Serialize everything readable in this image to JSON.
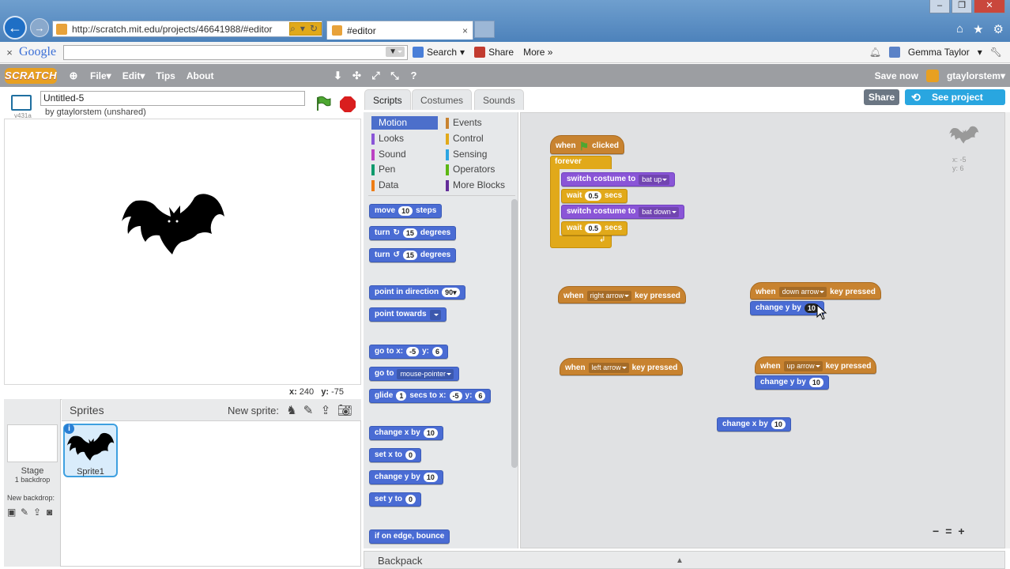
{
  "browser": {
    "url": "http://scratch.mit.edu/projects/46641988/#editor",
    "tab_title": "#editor",
    "tab_close": "×",
    "back": "←",
    "forward": "→"
  },
  "google_toolbar": {
    "close": "×",
    "logo": "Google",
    "search_label": "Search",
    "share_label": "Share",
    "more_label": "More »",
    "user_name": "Gemma Taylor"
  },
  "scratch_menu": {
    "logo": "SCRATCH",
    "file": "File▾",
    "edit": "Edit▾",
    "tips": "Tips",
    "about": "About",
    "save_now": "Save now",
    "username": "gtaylorstem▾"
  },
  "project": {
    "title": "Untitled-5",
    "owner": "by gtaylorstem (unshared)",
    "version": "v431a"
  },
  "stage": {
    "mouse_x_label": "x:",
    "mouse_x": "240",
    "mouse_y_label": "y:",
    "mouse_y": "-75"
  },
  "sprites_pane": {
    "title": "Sprites",
    "new_sprite": "New sprite:",
    "stage_label": "Stage",
    "backdrop_count": "1 backdrop",
    "new_backdrop": "New backdrop:",
    "sprite1": "Sprite1",
    "info": "i"
  },
  "tabs": {
    "scripts": "Scripts",
    "costumes": "Costumes",
    "sounds": "Sounds",
    "share": "Share",
    "see_project": "See project page"
  },
  "categories": {
    "motion": "Motion",
    "looks": "Looks",
    "sound": "Sound",
    "pen": "Pen",
    "data": "Data",
    "events": "Events",
    "control": "Control",
    "sensing": "Sensing",
    "operators": "Operators",
    "more_blocks": "More Blocks",
    "colors": {
      "motion": "#4a6cd4",
      "looks": "#8a55d7",
      "sound": "#bb42c3",
      "pen": "#0e9a6c",
      "data": "#ee7d16",
      "events": "#c88330",
      "control": "#e1a91a",
      "sensing": "#2ca5e2",
      "operators": "#5cb712",
      "more_blocks": "#632d99"
    }
  },
  "palette": {
    "move": "move",
    "move_val": "10",
    "steps": "steps",
    "turn": "turn",
    "turn_cw_val": "15",
    "turn_ccw_val": "15",
    "degrees": "degrees",
    "point_dir": "point in direction",
    "point_dir_val": "90▾",
    "point_towards": "point towards",
    "goto_xy": "go to x:",
    "goto_x": "-5",
    "y_label": "y:",
    "goto_y": "6",
    "goto": "go to",
    "goto_target": "mouse-pointer",
    "glide": "glide",
    "glide_secs": "1",
    "secs_to_x": "secs to x:",
    "glide_x": "-5",
    "glide_y": "6",
    "change_x": "change x by",
    "change_x_val": "10",
    "set_x": "set x to",
    "set_x_val": "0",
    "change_y": "change y by",
    "change_y_val": "10",
    "set_y": "set y to",
    "set_y_val": "0",
    "bounce": "if on edge, bounce"
  },
  "scripts": {
    "when": "when",
    "clicked": "clicked",
    "forever": "forever",
    "switch_costume": "switch costume to",
    "costume_up": "bat up",
    "costume_down": "bat down",
    "wait": "wait",
    "wait_val": "0.5",
    "secs": "secs",
    "key_pressed": "key pressed",
    "right_arrow": "right arrow",
    "left_arrow": "left arrow",
    "down_arrow": "down arrow",
    "up_arrow": "up arrow",
    "change_y": "change y by",
    "change_y_down_val": "10",
    "change_y_up_val": "10",
    "change_x": "change x by",
    "change_x_val": "10",
    "sprite_x": "x: -5",
    "sprite_y": "y: 6",
    "zoom_out": "−",
    "zoom_reset": "=",
    "zoom_in": "+"
  },
  "backpack": {
    "label": "Backpack",
    "arrow": "▲"
  }
}
